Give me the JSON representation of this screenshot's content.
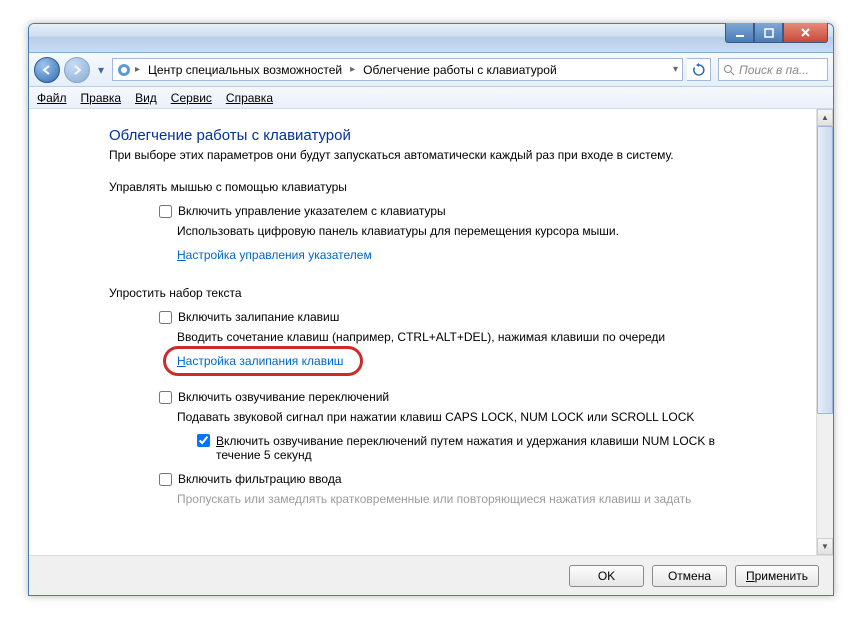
{
  "titlebar": {},
  "nav": {
    "crumb1": "Центр специальных возможностей",
    "crumb2": "Облегчение работы с клавиатурой",
    "search_placeholder": "Поиск в па..."
  },
  "menu": {
    "file": "Файл",
    "edit": "Правка",
    "view": "Вид",
    "tools": "Сервис",
    "help": "Справка"
  },
  "page": {
    "title": "Облегчение работы с клавиатурой",
    "desc": "При выборе этих параметров они будут запускаться автоматически каждый раз при входе в систему.",
    "group1": {
      "label": "Управлять мышью с помощью клавиатуры",
      "cb1": "Включить управление указателем с клавиатуры",
      "desc1": "Использовать цифровую панель клавиатуры для перемещения курсора мыши.",
      "link1": "Настройка управления указателем"
    },
    "group2": {
      "label": "Упростить набор текста",
      "cb1": "Включить залипание клавиш",
      "desc1": "Вводить сочетание клавиш (например, CTRL+ALT+DEL), нажимая клавиши по очереди",
      "link1": "Настройка залипания клавиш",
      "cb2": "Включить озвучивание переключений",
      "desc2": "Подавать звуковой сигнал при нажатии клавиш CAPS LOCK, NUM LOCK или SCROLL LOCK",
      "sub_cb": "Включить озвучивание переключений путем нажатия и удержания клавиши NUM LOCK в течение 5 секунд",
      "cb3": "Включить фильтрацию ввода",
      "desc3_partial": "Пропускать или замедлять кратковременные или повторяющиеся нажатия клавиш и задать"
    }
  },
  "buttons": {
    "ok": "OK",
    "cancel": "Отмена",
    "apply": "Применить"
  }
}
